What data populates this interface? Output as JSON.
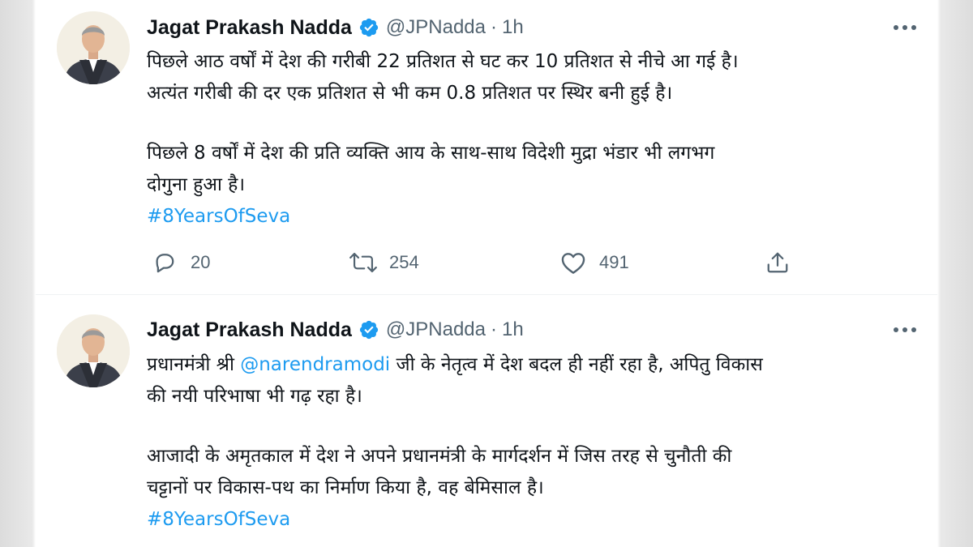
{
  "tweets": [
    {
      "author": {
        "name": "Jagat Prakash Nadda",
        "handle": "@JPNadda",
        "time": "1h",
        "dot": "·"
      },
      "lines": [
        "पिछले आठ वर्षों में देश की गरीबी 22 प्रतिशत से घट कर 10 प्रतिशत से नीचे आ गई है।",
        "अत्यंत गरीबी की दर एक प्रतिशत से भी कम 0.8 प्रतिशत पर स्थिर बनी हुई है।",
        "पिछले 8 वर्षों में देश की प्रति व्यक्ति आय के साथ-साथ विदेशी मुद्रा भंडार भी लगभग",
        "दोगुना हुआ है।"
      ],
      "hashtag": "#8YearsOfSeva",
      "stats": {
        "replies": "20",
        "retweets": "254",
        "likes": "491"
      }
    },
    {
      "author": {
        "name": "Jagat Prakash Nadda",
        "handle": "@JPNadda",
        "time": "1h",
        "dot": "·"
      },
      "line1_before": "प्रधानमंत्री श्री ",
      "mention": "@narendramodi",
      "line1_after": " जी के नेतृत्व में देश बदल ही नहीं रहा है, अपितु विकास",
      "lines": [
        "की नयी परिभाषा भी गढ़ रहा है।",
        "आजादी के अमृतकाल में देश ने अपने प्रधानमंत्री के मार्गदर्शन में जिस तरह से चुनौती की",
        "चट्टानों पर विकास-पथ का निर्माण किया है, वह बेमिसाल है।"
      ],
      "hashtag": "#8YearsOfSeva"
    }
  ],
  "icons": {
    "verified": "verified-badge-icon",
    "more": "more-options-icon",
    "reply": "reply-icon",
    "retweet": "retweet-icon",
    "like": "heart-icon",
    "share": "share-icon"
  },
  "colors": {
    "accent": "#1d9bf0",
    "text": "#0f1419",
    "secondary": "#536471"
  }
}
